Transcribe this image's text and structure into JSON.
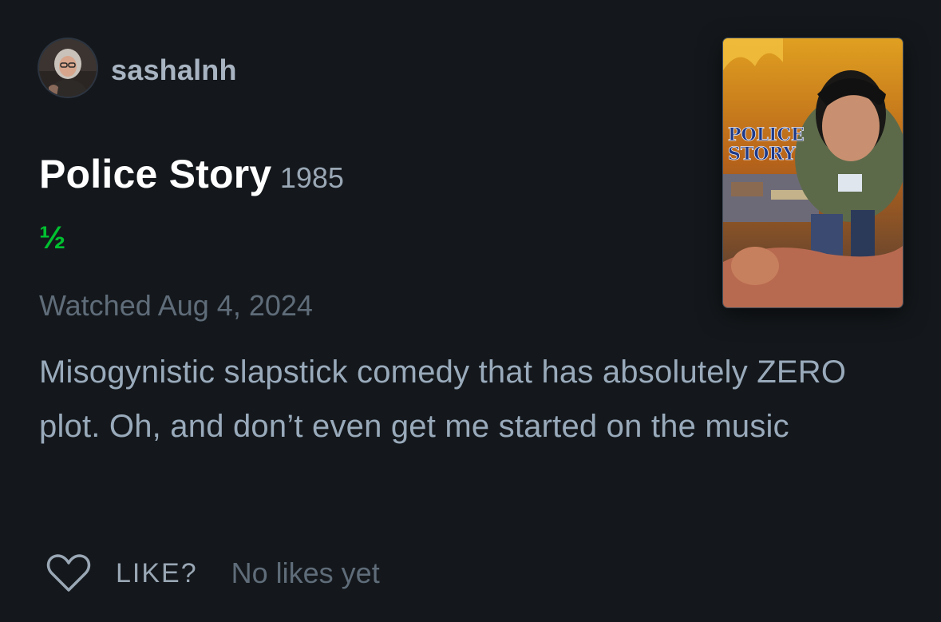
{
  "review": {
    "username": "sashalnh",
    "film_title": "Police Story",
    "film_year": "1985",
    "rating": "½",
    "watched_label": "Watched Aug 4, 2024",
    "text": "Misogynistic slapstick comedy that has absolutely ZERO plot. Oh, and don’t even get me started on the music",
    "poster_logo": "POLICE STORY"
  },
  "actions": {
    "like_label": "LIKE?",
    "likes_count": "No likes yet",
    "icon": "heart-outline-icon"
  },
  "colors": {
    "background": "#14181c",
    "rating_green": "#00c030",
    "text_primary": "#ffffff",
    "text_secondary": "#99aabb",
    "text_muted": "#5f6c79"
  }
}
